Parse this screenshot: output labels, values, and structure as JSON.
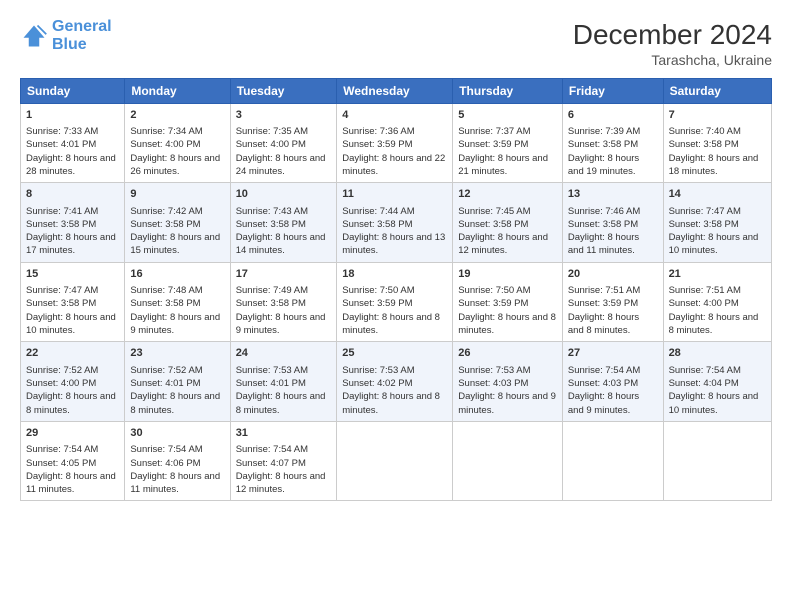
{
  "logo": {
    "line1": "General",
    "line2": "Blue"
  },
  "title": "December 2024",
  "subtitle": "Tarashcha, Ukraine",
  "days_of_week": [
    "Sunday",
    "Monday",
    "Tuesday",
    "Wednesday",
    "Thursday",
    "Friday",
    "Saturday"
  ],
  "weeks": [
    [
      {
        "day": "1",
        "sunrise": "7:33 AM",
        "sunset": "4:01 PM",
        "daylight": "8 hours and 28 minutes."
      },
      {
        "day": "2",
        "sunrise": "7:34 AM",
        "sunset": "4:00 PM",
        "daylight": "8 hours and 26 minutes."
      },
      {
        "day": "3",
        "sunrise": "7:35 AM",
        "sunset": "4:00 PM",
        "daylight": "8 hours and 24 minutes."
      },
      {
        "day": "4",
        "sunrise": "7:36 AM",
        "sunset": "3:59 PM",
        "daylight": "8 hours and 22 minutes."
      },
      {
        "day": "5",
        "sunrise": "7:37 AM",
        "sunset": "3:59 PM",
        "daylight": "8 hours and 21 minutes."
      },
      {
        "day": "6",
        "sunrise": "7:39 AM",
        "sunset": "3:58 PM",
        "daylight": "8 hours and 19 minutes."
      },
      {
        "day": "7",
        "sunrise": "7:40 AM",
        "sunset": "3:58 PM",
        "daylight": "8 hours and 18 minutes."
      }
    ],
    [
      {
        "day": "8",
        "sunrise": "7:41 AM",
        "sunset": "3:58 PM",
        "daylight": "8 hours and 17 minutes."
      },
      {
        "day": "9",
        "sunrise": "7:42 AM",
        "sunset": "3:58 PM",
        "daylight": "8 hours and 15 minutes."
      },
      {
        "day": "10",
        "sunrise": "7:43 AM",
        "sunset": "3:58 PM",
        "daylight": "8 hours and 14 minutes."
      },
      {
        "day": "11",
        "sunrise": "7:44 AM",
        "sunset": "3:58 PM",
        "daylight": "8 hours and 13 minutes."
      },
      {
        "day": "12",
        "sunrise": "7:45 AM",
        "sunset": "3:58 PM",
        "daylight": "8 hours and 12 minutes."
      },
      {
        "day": "13",
        "sunrise": "7:46 AM",
        "sunset": "3:58 PM",
        "daylight": "8 hours and 11 minutes."
      },
      {
        "day": "14",
        "sunrise": "7:47 AM",
        "sunset": "3:58 PM",
        "daylight": "8 hours and 10 minutes."
      }
    ],
    [
      {
        "day": "15",
        "sunrise": "7:47 AM",
        "sunset": "3:58 PM",
        "daylight": "8 hours and 10 minutes."
      },
      {
        "day": "16",
        "sunrise": "7:48 AM",
        "sunset": "3:58 PM",
        "daylight": "8 hours and 9 minutes."
      },
      {
        "day": "17",
        "sunrise": "7:49 AM",
        "sunset": "3:58 PM",
        "daylight": "8 hours and 9 minutes."
      },
      {
        "day": "18",
        "sunrise": "7:50 AM",
        "sunset": "3:59 PM",
        "daylight": "8 hours and 8 minutes."
      },
      {
        "day": "19",
        "sunrise": "7:50 AM",
        "sunset": "3:59 PM",
        "daylight": "8 hours and 8 minutes."
      },
      {
        "day": "20",
        "sunrise": "7:51 AM",
        "sunset": "3:59 PM",
        "daylight": "8 hours and 8 minutes."
      },
      {
        "day": "21",
        "sunrise": "7:51 AM",
        "sunset": "4:00 PM",
        "daylight": "8 hours and 8 minutes."
      }
    ],
    [
      {
        "day": "22",
        "sunrise": "7:52 AM",
        "sunset": "4:00 PM",
        "daylight": "8 hours and 8 minutes."
      },
      {
        "day": "23",
        "sunrise": "7:52 AM",
        "sunset": "4:01 PM",
        "daylight": "8 hours and 8 minutes."
      },
      {
        "day": "24",
        "sunrise": "7:53 AM",
        "sunset": "4:01 PM",
        "daylight": "8 hours and 8 minutes."
      },
      {
        "day": "25",
        "sunrise": "7:53 AM",
        "sunset": "4:02 PM",
        "daylight": "8 hours and 8 minutes."
      },
      {
        "day": "26",
        "sunrise": "7:53 AM",
        "sunset": "4:03 PM",
        "daylight": "8 hours and 9 minutes."
      },
      {
        "day": "27",
        "sunrise": "7:54 AM",
        "sunset": "4:03 PM",
        "daylight": "8 hours and 9 minutes."
      },
      {
        "day": "28",
        "sunrise": "7:54 AM",
        "sunset": "4:04 PM",
        "daylight": "8 hours and 10 minutes."
      }
    ],
    [
      {
        "day": "29",
        "sunrise": "7:54 AM",
        "sunset": "4:05 PM",
        "daylight": "8 hours and 11 minutes."
      },
      {
        "day": "30",
        "sunrise": "7:54 AM",
        "sunset": "4:06 PM",
        "daylight": "8 hours and 11 minutes."
      },
      {
        "day": "31",
        "sunrise": "7:54 AM",
        "sunset": "4:07 PM",
        "daylight": "8 hours and 12 minutes."
      },
      null,
      null,
      null,
      null
    ]
  ]
}
